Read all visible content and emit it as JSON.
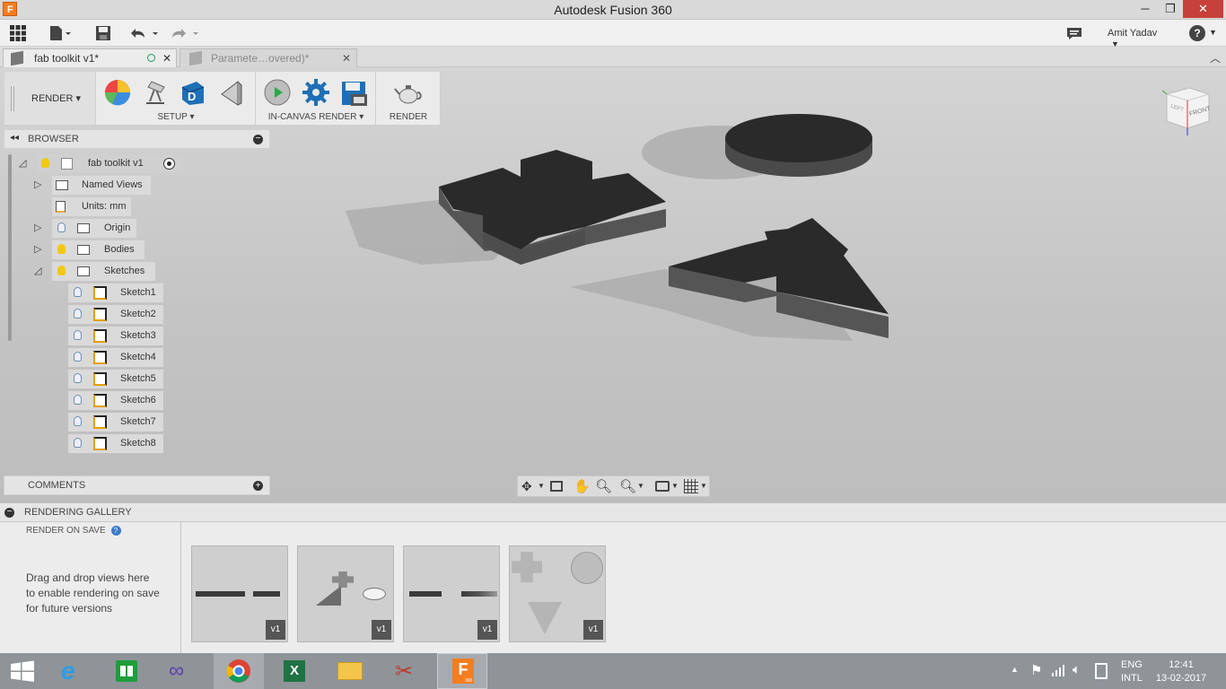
{
  "window": {
    "title": "Autodesk Fusion 360",
    "minimize": "─",
    "restore": "❐",
    "close": "✕"
  },
  "quickbar": {
    "user_name": "Amit Yadav",
    "user_caret": "▼",
    "help": "?",
    "help_caret": "▼"
  },
  "tabs": [
    {
      "label": "fab toolkit v1*",
      "active": true
    },
    {
      "label": "Paramete…overed)*",
      "active": false
    }
  ],
  "ribbon": {
    "workspace": "RENDER ▾",
    "setup_label": "SETUP ▾",
    "incanvas_label": "IN-CANVAS RENDER ▾",
    "render_label": "RENDER"
  },
  "browser": {
    "title": "BROWSER",
    "root": "fab toolkit v1",
    "items": [
      {
        "label": "Named Views"
      },
      {
        "label": "Units: mm"
      },
      {
        "label": "Origin"
      },
      {
        "label": "Bodies"
      },
      {
        "label": "Sketches"
      }
    ],
    "sketches": [
      "Sketch1",
      "Sketch2",
      "Sketch3",
      "Sketch4",
      "Sketch5",
      "Sketch6",
      "Sketch7",
      "Sketch8"
    ]
  },
  "comments": {
    "title": "COMMENTS"
  },
  "viewcube": {
    "front": "FRONT",
    "left": "LEFT"
  },
  "gallery": {
    "title": "RENDERING GALLERY",
    "render_on_save": "RENDER ON SAVE",
    "help": "?",
    "hint": "Drag and drop views here to enable rendering on save for future versions",
    "thumbnails": [
      {
        "version": "v1"
      },
      {
        "version": "v1"
      },
      {
        "version": "v1"
      },
      {
        "version": "v1"
      }
    ]
  },
  "taskbar": {
    "lang_top": "ENG",
    "lang_bottom": "INTL",
    "time": "12:41",
    "date": "13-02-2017",
    "fusion_sub": "360"
  },
  "colors": {
    "accent_blue": "#1e6fb5",
    "bulb_yellow": "#f2c811",
    "taskbar": "#8f9499",
    "body_dark": "#2c2c2c"
  }
}
